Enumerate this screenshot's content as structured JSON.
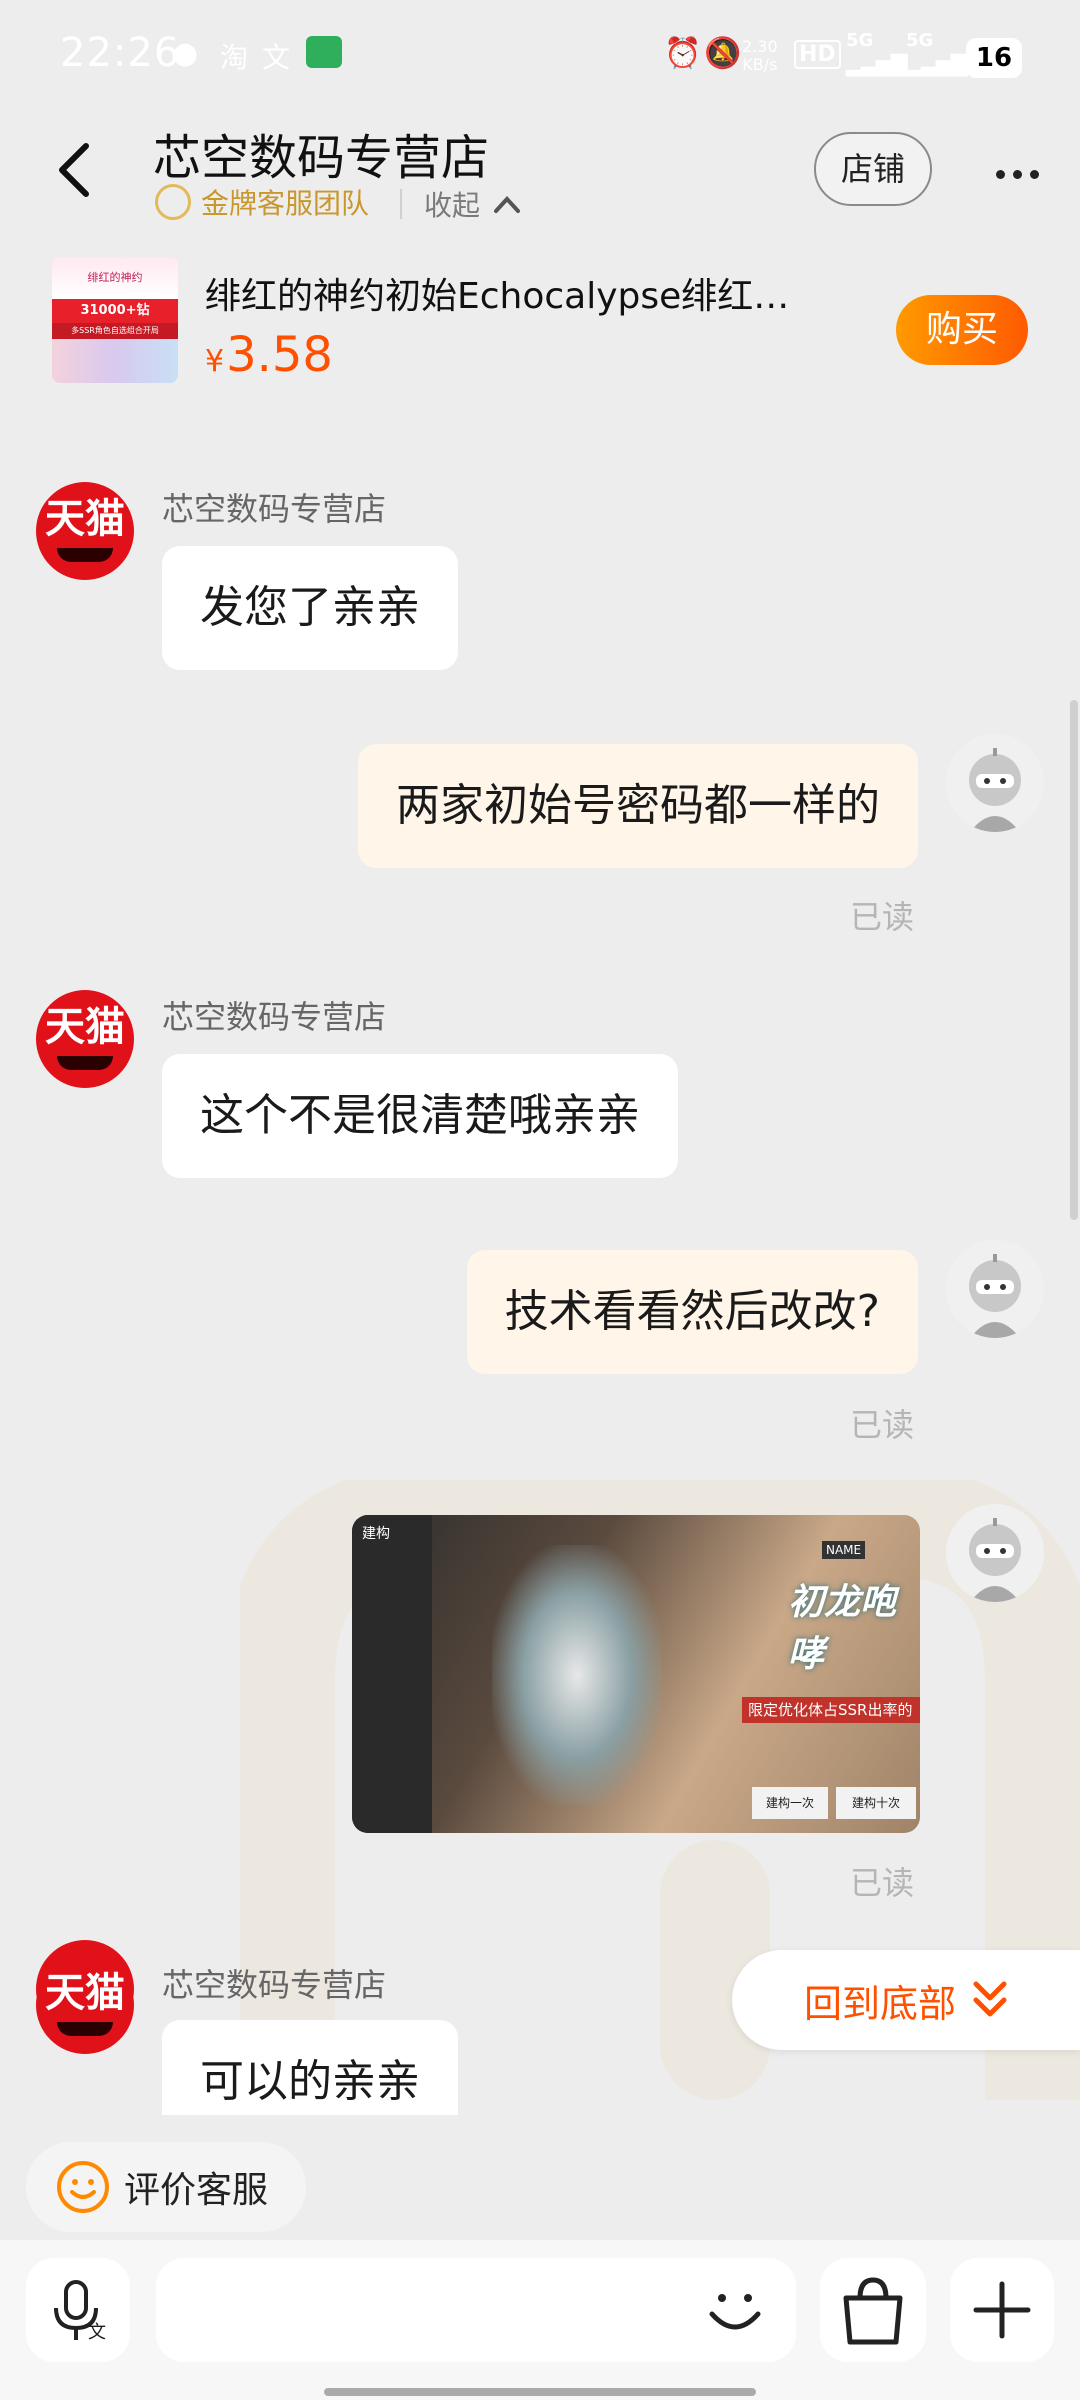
{
  "status_bar": {
    "time": "22:26",
    "net_speed_value": "2.30",
    "net_speed_unit": "KB/s",
    "hd": "HD",
    "signal1": "5G",
    "signal2": "5G",
    "battery": "16"
  },
  "header": {
    "shop_name": "芯空数码专营店",
    "team_label": "金牌客服团队",
    "collapse_label": "收起",
    "store_button": "店铺"
  },
  "product": {
    "title": "绯红的神约初始Echocalypse绯红…",
    "currency": "¥",
    "price": "3.58",
    "buy_button": "购买",
    "thumb_text_1": "绯红的神约",
    "thumb_text_2": "31000+钻",
    "thumb_text_3": "多SSR角色自选组合开局"
  },
  "messages": [
    {
      "side": "left",
      "sender": "芯空数码专营店",
      "avatar": "天猫",
      "text": "发您了亲亲"
    },
    {
      "side": "right",
      "text": "两家初始号密码都一样的",
      "status": "已读"
    },
    {
      "side": "left",
      "sender": "芯空数码专营店",
      "avatar": "天猫",
      "text": "这个不是很清楚哦亲亲"
    },
    {
      "side": "right",
      "text": "技术看看然后改改?",
      "status": "已读"
    },
    {
      "side": "right",
      "type": "image",
      "status": "已读",
      "image_text": {
        "top_left": "建构",
        "banner": "初龙咆哮",
        "notice": "限定优化体占SSR出率的",
        "btn1": "建构一次",
        "btn2": "建构十次",
        "name_tag": "NAME"
      }
    },
    {
      "side": "left",
      "sender": "芯空数码专营店",
      "avatar": "天猫",
      "text": "可以的亲亲"
    }
  ],
  "back_to_bottom": "回到底部",
  "rate_service": "评价客服",
  "input": {
    "placeholder": "",
    "voice_sub": "文"
  },
  "colors": {
    "accent": "#ff5000",
    "tmall_red": "#e1111a",
    "gold": "#c9972c",
    "bubble_right": "#fff6e9"
  },
  "icons": [
    "back-icon",
    "more-icon",
    "smile-icon",
    "chevron-up-icon",
    "voice-icon",
    "emoji-icon",
    "shopping-bag-icon",
    "plus-icon",
    "chevron-double-down-icon"
  ]
}
